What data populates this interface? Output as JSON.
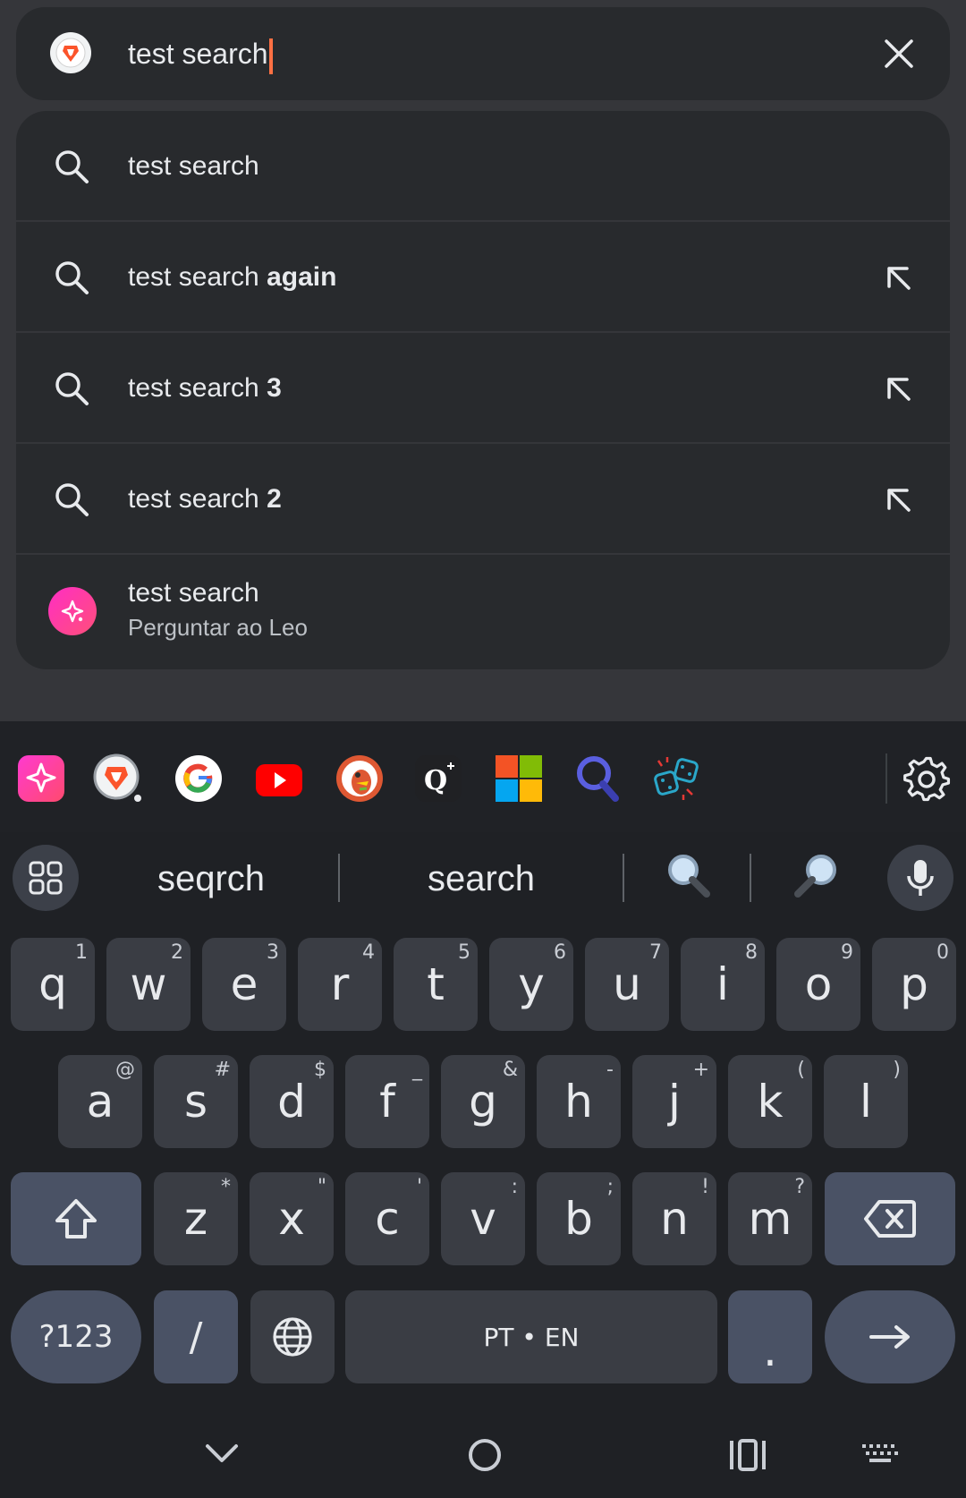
{
  "search": {
    "query": "test search",
    "clear_icon": "close-icon"
  },
  "suggestions": [
    {
      "prefix": "test search",
      "bold": "",
      "icon": "search-icon",
      "fill_icon": false
    },
    {
      "prefix": "test search ",
      "bold": "again",
      "icon": "search-icon",
      "fill_icon": true
    },
    {
      "prefix": "test search ",
      "bold": "3",
      "icon": "search-icon",
      "fill_icon": true
    },
    {
      "prefix": "test search ",
      "bold": "2",
      "icon": "search-icon",
      "fill_icon": true
    }
  ],
  "leo_suggestion": {
    "title": "test search",
    "subtitle": "Perguntar ao Leo",
    "icon": "leo-sparkle-icon"
  },
  "keyboard_toolbar": {
    "items": [
      "leo-icon",
      "brave-icon",
      "google-icon",
      "youtube-icon",
      "duckduckgo-icon",
      "qwant-icon",
      "bing-icon",
      "brave-search-icon",
      "dice-icon",
      "settings-icon"
    ]
  },
  "candidates": {
    "words": [
      "seqrch",
      "search"
    ],
    "emoji": [
      "🔍",
      "🔎"
    ]
  },
  "keys": {
    "row1": [
      {
        "k": "q",
        "h": "1"
      },
      {
        "k": "w",
        "h": "2"
      },
      {
        "k": "e",
        "h": "3"
      },
      {
        "k": "r",
        "h": "4"
      },
      {
        "k": "t",
        "h": "5"
      },
      {
        "k": "y",
        "h": "6"
      },
      {
        "k": "u",
        "h": "7"
      },
      {
        "k": "i",
        "h": "8"
      },
      {
        "k": "o",
        "h": "9"
      },
      {
        "k": "p",
        "h": "0"
      }
    ],
    "row2": [
      {
        "k": "a",
        "h": "@"
      },
      {
        "k": "s",
        "h": "#"
      },
      {
        "k": "d",
        "h": "$"
      },
      {
        "k": "f",
        "h": "_"
      },
      {
        "k": "g",
        "h": "&"
      },
      {
        "k": "h",
        "h": "-"
      },
      {
        "k": "j",
        "h": "+"
      },
      {
        "k": "k",
        "h": "("
      },
      {
        "k": "l",
        "h": ")"
      }
    ],
    "row3": [
      {
        "k": "z",
        "h": "*"
      },
      {
        "k": "x",
        "h": "\""
      },
      {
        "k": "c",
        "h": "'"
      },
      {
        "k": "v",
        "h": ":"
      },
      {
        "k": "b",
        "h": ";"
      },
      {
        "k": "n",
        "h": "!"
      },
      {
        "k": "m",
        "h": "?"
      }
    ],
    "symbols_label": "?123",
    "slash_label": "/",
    "space_label": "PT • EN",
    "period_label": ".",
    "enter_icon": "arrow-right-icon"
  },
  "colors": {
    "accent_caret": "#ff7043",
    "leo_gradient": "#ff2ec4",
    "key_bg": "#3a3d44",
    "func_key_bg": "#4a5265"
  }
}
